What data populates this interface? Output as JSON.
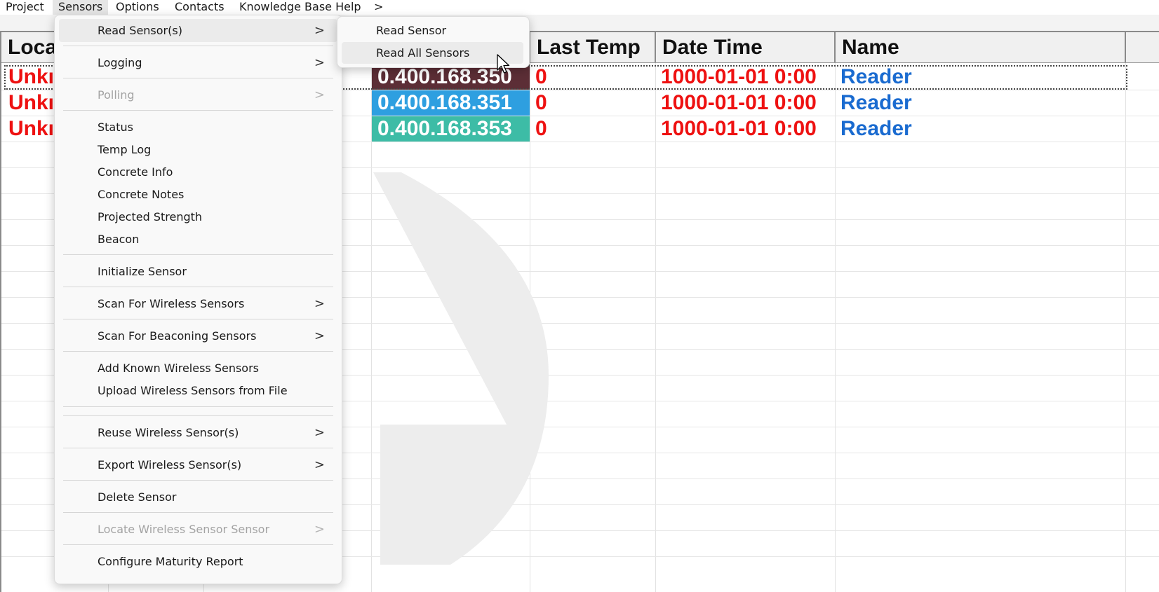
{
  "menubar": {
    "items": [
      "Project",
      "Sensors",
      "Options",
      "Contacts",
      "Knowledge Base Help",
      ">"
    ]
  },
  "table": {
    "columns": [
      "Loca",
      "",
      "",
      "Last Temp",
      "Date Time",
      "Name"
    ],
    "rows": [
      {
        "location": "Unkı",
        "address": "0.400.168.350",
        "address_color": "#5c2e36",
        "last_temp": "0",
        "date_time": "1000-01-01 0:00",
        "name": "Reader"
      },
      {
        "location": "Unkı",
        "address": "0.400.168.351",
        "address_color": "#2e9fe0",
        "last_temp": "0",
        "date_time": "1000-01-01 0:00",
        "name": "Reader"
      },
      {
        "location": "Unkı",
        "address": "0.400.168.353",
        "address_color": "#3dbca6",
        "last_temp": "0",
        "date_time": "1000-01-01 0:00",
        "name": "Reader"
      }
    ]
  },
  "sensors_menu": {
    "read_sensors": "Read Sensor(s)",
    "logging": "Logging",
    "polling": "Polling",
    "status": "Status",
    "temp_log": "Temp Log",
    "concrete_info": "Concrete Info",
    "concrete_notes": "Concrete Notes",
    "projected_strength": "Projected Strength",
    "beacon": "Beacon",
    "initialize_sensor": "Initialize Sensor",
    "scan_wireless": "Scan For Wireless Sensors",
    "scan_beaconing": "Scan For Beaconing Sensors",
    "add_known": "Add Known Wireless Sensors",
    "upload_from_file": "Upload Wireless Sensors from File",
    "reuse": "Reuse Wireless Sensor(s)",
    "export": "Export Wireless Sensor(s)",
    "delete_sensor": "Delete Sensor",
    "locate": "Locate Wireless Sensor Sensor",
    "configure_maturity": "Configure Maturity Report",
    "submenu_arrow": ">"
  },
  "read_submenu": {
    "read_sensor": "Read Sensor",
    "read_all_sensors": "Read All Sensors"
  },
  "colors": {
    "error_red": "#ee1111",
    "name_blue": "#1a6bd0"
  },
  "icons": {
    "cursor": "mouse-pointer-icon",
    "submenu": "chevron-right-icon"
  }
}
